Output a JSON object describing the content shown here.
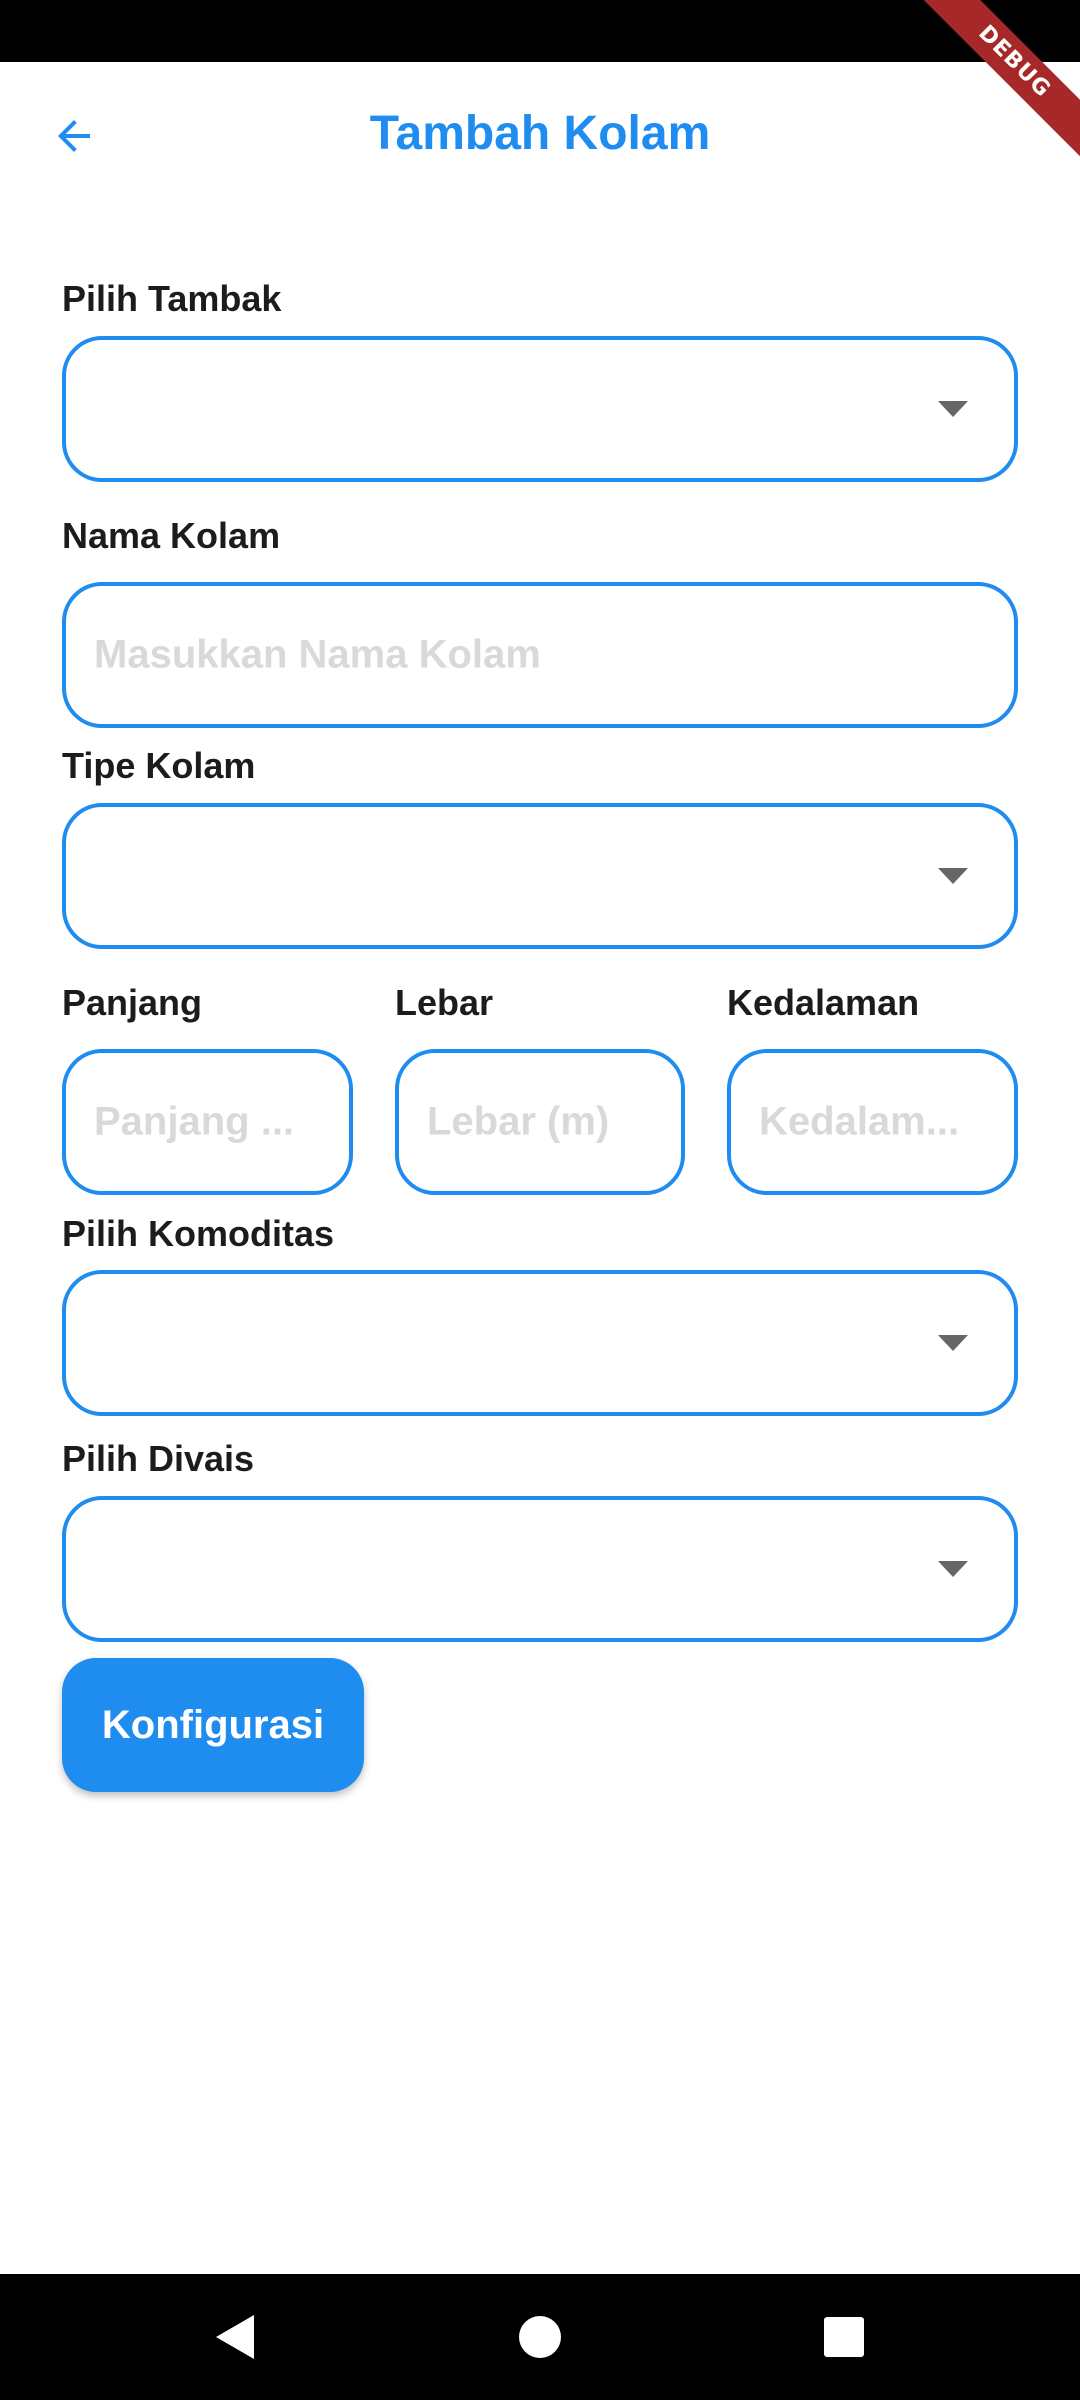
{
  "app_bar": {
    "title": "Tambah Kolam",
    "back_icon": "arrow-left-icon",
    "accent_color": "#1f8cf0"
  },
  "debug_banner": {
    "text": "DEBUG"
  },
  "form": {
    "tambak": {
      "label": "Pilih Tambak",
      "value": ""
    },
    "nama_kolam": {
      "label": "Nama Kolam",
      "placeholder": "Masukkan Nama Kolam",
      "value": ""
    },
    "tipe_kolam": {
      "label": "Tipe Kolam",
      "value": ""
    },
    "panjang": {
      "label": "Panjang",
      "placeholder": "Panjang ...",
      "value": ""
    },
    "lebar": {
      "label": "Lebar",
      "placeholder": "Lebar (m)",
      "value": ""
    },
    "kedalaman": {
      "label": "Kedalaman",
      "placeholder": "Kedalam...",
      "value": ""
    },
    "komoditas": {
      "label": "Pilih Komoditas",
      "value": ""
    },
    "divais": {
      "label": "Pilih Divais",
      "value": ""
    },
    "dropdown_icon": "caret-down-icon"
  },
  "actions": {
    "configure_label": "Konfigurasi"
  },
  "system_nav": {
    "back_icon": "nav-back-icon",
    "home_icon": "nav-home-icon",
    "recents_icon": "nav-recents-icon"
  }
}
